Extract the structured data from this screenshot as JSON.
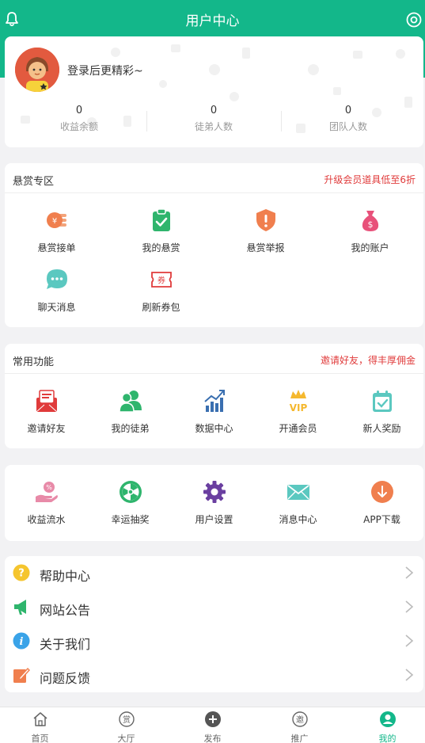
{
  "header": {
    "title": "用户中心",
    "bell_icon": "bell-icon",
    "settings_icon": "settings-icon"
  },
  "profile": {
    "login_prompt": "登录后更精彩~",
    "stats": [
      {
        "value": "0",
        "label": "收益余额"
      },
      {
        "value": "0",
        "label": "徒弟人数"
      },
      {
        "value": "0",
        "label": "团队人数"
      }
    ]
  },
  "reward_zone": {
    "title": "悬赏专区",
    "promo": "升级会员道具低至6折",
    "items": [
      {
        "label": "悬赏接单",
        "icon": "coins-icon",
        "color": "#f07f4e"
      },
      {
        "label": "我的悬赏",
        "icon": "clipboard-check-icon",
        "color": "#2fb56d"
      },
      {
        "label": "悬赏举报",
        "icon": "shield-alert-icon",
        "color": "#f07f4e"
      },
      {
        "label": "我的账户",
        "icon": "money-bag-icon",
        "color": "#e8517a"
      },
      {
        "label": "聊天消息",
        "icon": "chat-bubble-icon",
        "color": "#5bc8c0"
      },
      {
        "label": "刷新券包",
        "icon": "coupon-icon",
        "color": "#e03b3b"
      }
    ]
  },
  "common_functions": {
    "title": "常用功能",
    "promo": "邀请好友，得丰厚佣金",
    "items": [
      {
        "label": "邀请好友",
        "icon": "invite-envelope-icon",
        "color": "#e03b3b"
      },
      {
        "label": "我的徒弟",
        "icon": "users-icon",
        "color": "#2fb56d"
      },
      {
        "label": "数据中心",
        "icon": "bar-chart-icon",
        "color": "#3a6fb0"
      },
      {
        "label": "开通会员",
        "icon": "vip-crown-icon",
        "color": "#f5b82e"
      },
      {
        "label": "新人奖励",
        "icon": "calendar-check-icon",
        "color": "#5bc8c0"
      }
    ]
  },
  "more_functions": {
    "items": [
      {
        "label": "收益流水",
        "icon": "hand-coin-icon",
        "color": "#e88aa8"
      },
      {
        "label": "幸运抽奖",
        "icon": "lucky-wheel-icon",
        "color": "#2fb56d"
      },
      {
        "label": "用户设置",
        "icon": "gear-icon",
        "color": "#6a3fa0"
      },
      {
        "label": "消息中心",
        "icon": "mail-icon",
        "color": "#5bc8c0"
      },
      {
        "label": "APP下载",
        "icon": "download-icon",
        "color": "#f07f4e"
      }
    ]
  },
  "menu": [
    {
      "label": "帮助中心",
      "icon": "question-icon",
      "color": "#f5c52e"
    },
    {
      "label": "网站公告",
      "icon": "megaphone-icon",
      "color": "#2fb56d"
    },
    {
      "label": "关于我们",
      "icon": "info-icon",
      "color": "#3aa3e8"
    },
    {
      "label": "问题反馈",
      "icon": "edit-icon",
      "color": "#f07f4e"
    }
  ],
  "tabbar": {
    "active": "我的",
    "tabs": [
      {
        "label": "首页",
        "icon": "home-icon"
      },
      {
        "label": "大厅",
        "icon": "reward-hall-icon",
        "glyph": "赏"
      },
      {
        "label": "发布",
        "icon": "plus-circle-icon"
      },
      {
        "label": "推广",
        "icon": "invite-icon",
        "glyph": "邀"
      },
      {
        "label": "我的",
        "icon": "user-icon"
      }
    ]
  },
  "colors": {
    "brand": "#13b78a",
    "promo": "#e03b3b"
  }
}
